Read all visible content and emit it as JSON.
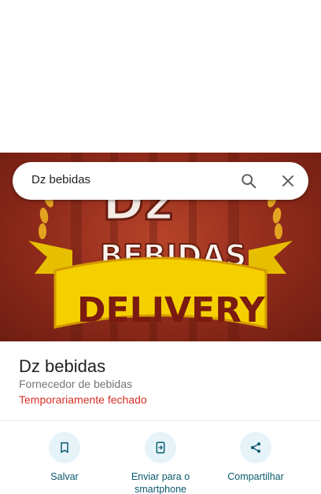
{
  "hero": {
    "logo_line1": "Dz",
    "logo_line2": "BEBIDAS",
    "logo_line3": "DELIVERY"
  },
  "search": {
    "query": "Dz bebidas",
    "search_icon": "search-icon",
    "close_icon": "close-icon"
  },
  "place": {
    "title": "Dz bebidas",
    "category": "Fornecedor de bebidas",
    "status": "Temporariamente fechado"
  },
  "actions": [
    {
      "label": "Salvar",
      "icon": "bookmark-icon"
    },
    {
      "label": "Enviar para o smartphone",
      "icon": "send-to-phone-icon"
    },
    {
      "label": "Compartilhar",
      "icon": "share-icon"
    }
  ],
  "colors": {
    "accent": "#0b5a6e",
    "action_bg": "#e6f4fa",
    "status_closed": "#d93025",
    "hero_bg": "#8e2a1a",
    "ribbon_yellow": "#f5d000",
    "logo_text": "#7a1a10"
  }
}
